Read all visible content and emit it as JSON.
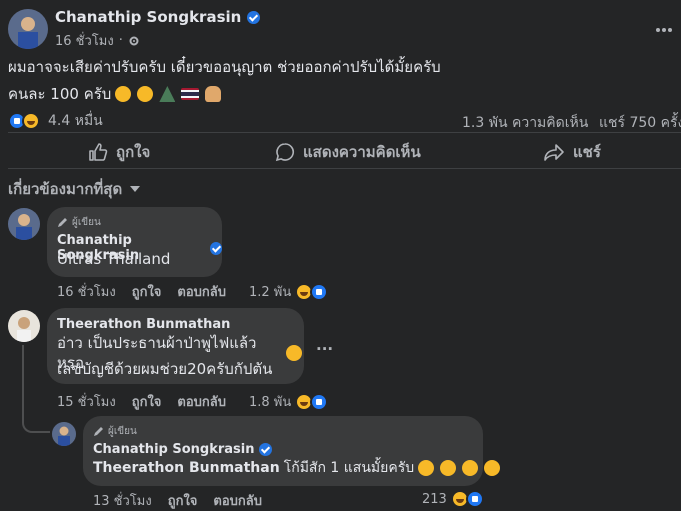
{
  "post": {
    "author": "Chanathip Songkrasin",
    "time": "16 ชั่วโมง",
    "text_line1": "ผมอาจจะเสียค่าปรับครับ เดี๋ยวขออนุญาต ช่วยออกค่าปรับได้มั้ยครับ",
    "text_line2": "คนละ 100 ครับ",
    "reactions_count": "4.4 หมื่น",
    "comments_count": "1.3 พัน ความคิดเห็น",
    "shares_count": "แชร์ 750 ครั้ง"
  },
  "actions": {
    "like": "ถูกใจ",
    "comment": "แสดงความคิดเห็น",
    "share": "แชร์"
  },
  "sort": {
    "label": "เกี่ยวข้องมากที่สุด"
  },
  "comments": [
    {
      "badge": "ผู้เขียน",
      "name": "Chanathip Songkrasin",
      "text": "Ultras Thailand",
      "time": "16 ชั่วโมง",
      "like": "ถูกใจ",
      "reply": "ตอบกลับ",
      "count": "1.2 พัน"
    },
    {
      "name": "Theerathon Bunmathan",
      "text1": "อ่าว เป็นประธานผ้าป่าพูไฟแล้วหรอ",
      "text2": "เลขบัญชีด้วยผมช่วย20ครับกัปตัน",
      "time": "15 ชั่วโมง",
      "like": "ถูกใจ",
      "reply": "ตอบกลับ",
      "count": "1.8 พัน",
      "more": "..."
    },
    {
      "badge": "ผู้เขียน",
      "name": "Chanathip Songkrasin",
      "mention": "Theerathon Bunmathan",
      "text": "โก้มีสัก 1 แสนมั้ยครับ",
      "time": "13 ชั่วโมง",
      "like": "ถูกใจ",
      "reply": "ตอบกลับ",
      "count": "213"
    }
  ],
  "icons": {
    "more": "more-horizontal-icon",
    "globe": "gear-icon",
    "like": "thumbs-up-icon",
    "comment": "comment-bubble-icon",
    "share": "share-arrow-icon",
    "chevron": "chevron-down-icon"
  }
}
